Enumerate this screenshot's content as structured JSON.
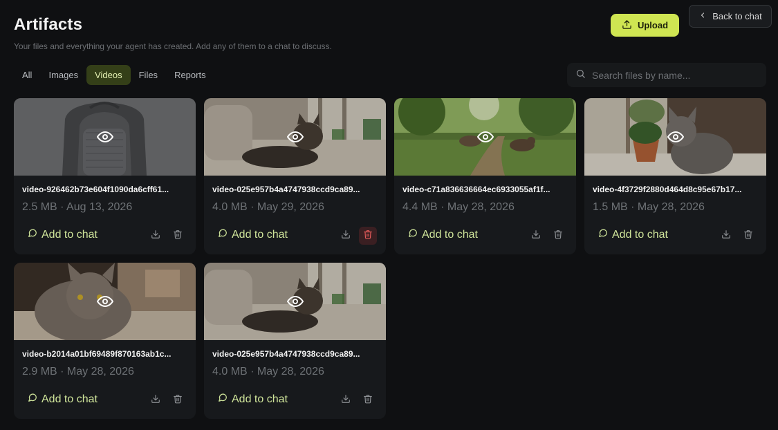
{
  "header": {
    "title": "Artifacts",
    "subtitle": "Your files and everything your agent has created. Add any of them to a chat to discuss."
  },
  "actions": {
    "upload_label": "Upload",
    "back_label": "Back to chat"
  },
  "tabs": [
    {
      "label": "All",
      "active": false
    },
    {
      "label": "Images",
      "active": false
    },
    {
      "label": "Videos",
      "active": true
    },
    {
      "label": "Files",
      "active": false
    },
    {
      "label": "Reports",
      "active": false
    }
  ],
  "search": {
    "placeholder": "Search files by name..."
  },
  "card_labels": {
    "add_to_chat": "Add to chat"
  },
  "files": [
    {
      "name": "video-926462b73e604f1090da6cff61...",
      "meta": "2.5 MB · Aug 13, 2026",
      "thumb": "backpack",
      "delete_highlighted": false
    },
    {
      "name": "video-025e957b4a4747938ccd9ca89...",
      "meta": "4.0 MB · May 29, 2026",
      "thumb": "cat-sofa",
      "delete_highlighted": true
    },
    {
      "name": "video-c71a836636664ec6933055af1f...",
      "meta": "4.4 MB · May 28, 2026",
      "thumb": "dogs-park",
      "delete_highlighted": false
    },
    {
      "name": "video-4f3729f2880d464d8c95e67b17...",
      "meta": "1.5 MB · May 28, 2026",
      "thumb": "cat-window",
      "delete_highlighted": false
    },
    {
      "name": "video-b2014a01bf69489f870163ab1c...",
      "meta": "2.9 MB · May 28, 2026",
      "thumb": "cat-closeup",
      "delete_highlighted": false
    },
    {
      "name": "video-025e957b4a4747938ccd9ca89...",
      "meta": "4.0 MB · May 28, 2026",
      "thumb": "cat-sofa",
      "delete_highlighted": false
    }
  ],
  "colors": {
    "accent": "#cfe552",
    "tab_active_bg": "#343f18",
    "danger": "#e35a5a"
  },
  "icons": [
    "upload-icon",
    "chevron-left-icon",
    "search-icon",
    "eye-icon",
    "chat-bubble-icon",
    "download-icon",
    "trash-icon"
  ]
}
